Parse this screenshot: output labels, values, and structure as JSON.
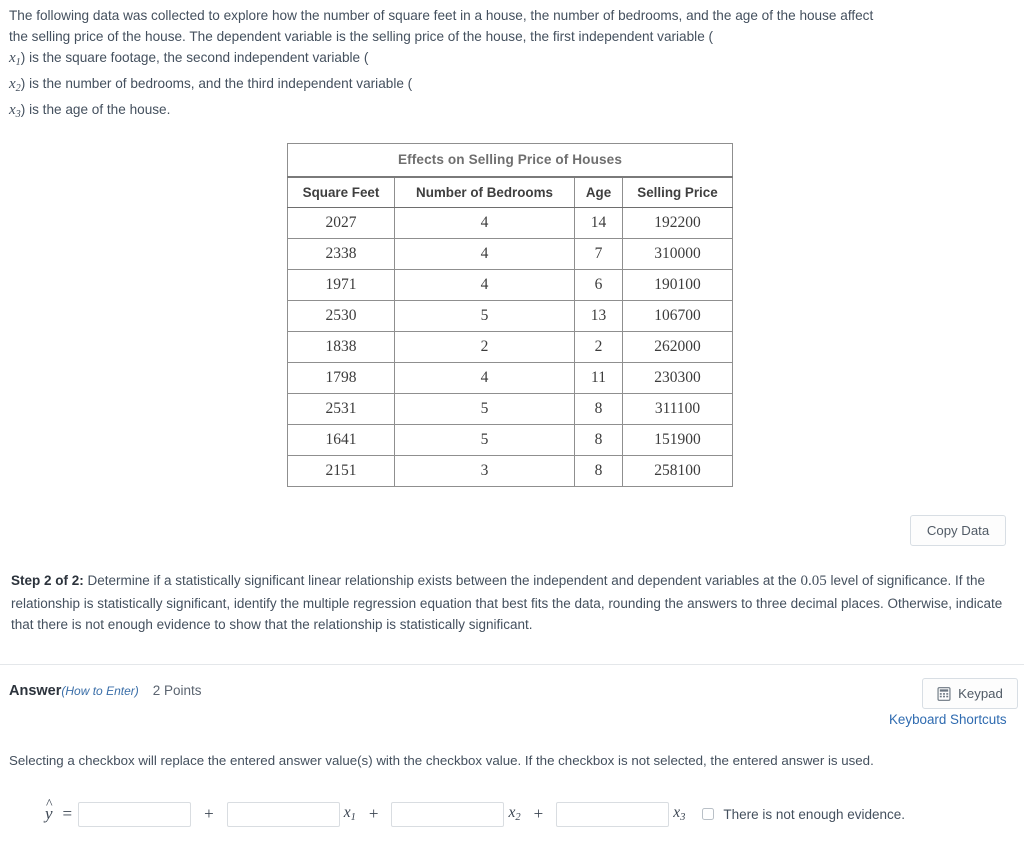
{
  "intro": {
    "line1": "The following data was collected to explore how the number of square feet in a house, the number of bedrooms, and the age of the house affect",
    "line2": "the selling price of the house. The dependent variable is the selling price of the house, the first independent variable (",
    "var1": "x",
    "var1_sub": "1",
    "line3": ") is the square footage, the second independent variable (",
    "var2": "x",
    "var2_sub": "2",
    "line4": ") is the number of bedrooms, and the third independent variable (",
    "var3": "x",
    "var3_sub": "3",
    "line5": ") is the age of the house."
  },
  "table": {
    "title": "Effects on Selling Price of Houses",
    "columns": [
      "Square Feet",
      "Number of Bedrooms",
      "Age",
      "Selling Price"
    ],
    "rows": [
      [
        "2027",
        "4",
        "14",
        "192200"
      ],
      [
        "2338",
        "4",
        "7",
        "310000"
      ],
      [
        "1971",
        "4",
        "6",
        "190100"
      ],
      [
        "2530",
        "5",
        "13",
        "106700"
      ],
      [
        "1838",
        "2",
        "2",
        "262000"
      ],
      [
        "1798",
        "4",
        "11",
        "230300"
      ],
      [
        "2531",
        "5",
        "8",
        "311100"
      ],
      [
        "1641",
        "5",
        "8",
        "151900"
      ],
      [
        "2151",
        "3",
        "8",
        "258100"
      ]
    ]
  },
  "copy_data": {
    "label": "Copy Data"
  },
  "step": {
    "heading": "Step 2 of 2:",
    "text_a": " Determine if a statistically significant linear relationship exists between the independent and dependent variables at the ",
    "alpha": "0.05",
    "text_b": " level of significance. If the relationship is statistically significant, identify the multiple regression equation that best fits the data, rounding the answers to three decimal places. Otherwise, indicate that there is not enough evidence to show that the relationship is statistically significant."
  },
  "answer": {
    "label": "Answer",
    "how_to_enter": "(How to Enter)",
    "points": "2 Points",
    "keypad_label": "Keypad",
    "keyboard_shortcuts": "Keyboard Shortcuts",
    "checkbox_note": "Selecting a checkbox will replace the entered answer value(s) with the checkbox value. If the checkbox is not selected, the entered answer is used."
  },
  "equation": {
    "yhat": "y",
    "hat": "^",
    "equals": "=",
    "plus": "+",
    "coef0_value": "",
    "coef1_value": "",
    "coef2_value": "",
    "coef3_value": "",
    "input_placeholder": "",
    "term1": "x",
    "term1_sub": "1",
    "term2": "x",
    "term2_sub": "2",
    "term3": "x",
    "term3_sub": "3",
    "not_enough_evidence": "There is not enough evidence."
  },
  "colors": {
    "link": "#2f6bb0",
    "text": "#44505e",
    "table_border": "#8f8f8f"
  }
}
